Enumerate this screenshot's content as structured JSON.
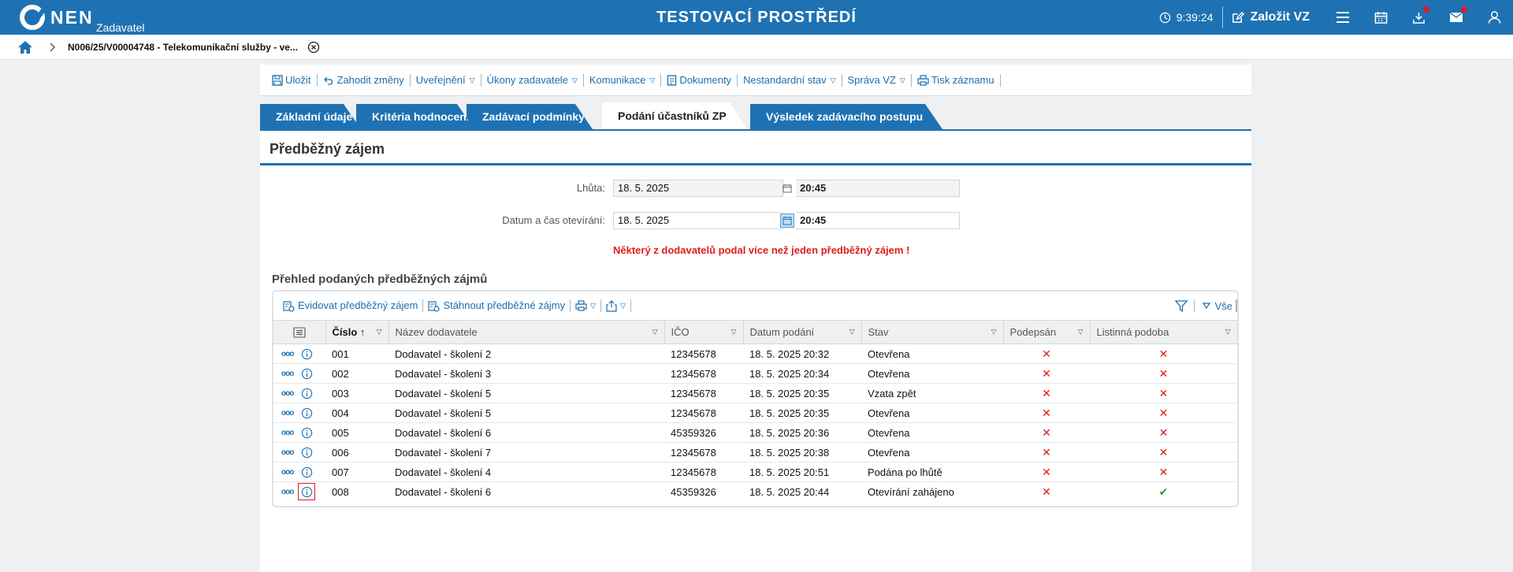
{
  "topbar": {
    "logo_text": "NEN",
    "logo_sub": "Zadavatel",
    "env_title": "TESTOVACÍ PROSTŘEDÍ",
    "timer": "9:39:24",
    "create_label": "Založit VZ",
    "icons": [
      "menu-icon",
      "calendar-icon",
      "download-icon",
      "mail-icon",
      "user-icon"
    ],
    "notification_color": "#e0192b"
  },
  "breadcrumb": {
    "text": "N006/25/V00004748 - Telekomunikační služby - ve..."
  },
  "toolbar": {
    "items": [
      {
        "label": "Uložit",
        "icon": "save-icon",
        "dropdown": false
      },
      {
        "label": "Zahodit změny",
        "icon": "undo-icon",
        "dropdown": false
      },
      {
        "label": "Uveřejnění",
        "icon": "",
        "dropdown": true
      },
      {
        "label": "Úkony zadavatele",
        "icon": "",
        "dropdown": true
      },
      {
        "label": "Komunikace",
        "icon": "",
        "dropdown": true
      },
      {
        "label": "Dokumenty",
        "icon": "document-icon",
        "dropdown": false
      },
      {
        "label": "Nestandardní stav",
        "icon": "",
        "dropdown": true
      },
      {
        "label": "Správa VZ",
        "icon": "",
        "dropdown": true
      },
      {
        "label": "Tisk záznamu",
        "icon": "print-icon",
        "dropdown": false
      }
    ]
  },
  "tabs": [
    {
      "label": "Základní údaje",
      "active": false
    },
    {
      "label": "Kritéria hodnocení",
      "active": false
    },
    {
      "label": "Zadávací podmínky",
      "active": false
    },
    {
      "label": "Podání účastníků ZP",
      "active": true
    },
    {
      "label": "Výsledek zadávacího postupu",
      "active": false
    }
  ],
  "section": {
    "title": "Předběžný zájem",
    "deadline": {
      "label": "Lhůta:",
      "date": "18. 5. 2025",
      "time": "20:45"
    },
    "opening": {
      "label": "Datum a čas otevírání:",
      "date": "18. 5. 2025",
      "time": "20:45"
    },
    "warning": "Některý z dodavatelů podal více než jeden předběžný zájem !",
    "overview_title": "Přehled podaných předběžných zájmů"
  },
  "grid": {
    "toolbar": {
      "register_label": "Evidovat předběžný zájem",
      "download_label": "Stáhnout předběžné zájmy",
      "filter_all_label": "Vše"
    },
    "columns": {
      "number": "Číslo",
      "supplier": "Název dodavatele",
      "ico": "IČO",
      "date": "Datum podání",
      "state": "Stav",
      "signed": "Podepsán",
      "paper": "Listinná podoba"
    },
    "rows": [
      {
        "number": "001",
        "supplier": "Dodavatel - školení 2",
        "ico": "12345678",
        "date": "18. 5. 2025 20:32",
        "state": "Otevřena",
        "signed": false,
        "paper": false
      },
      {
        "number": "002",
        "supplier": "Dodavatel - školení 3",
        "ico": "12345678",
        "date": "18. 5. 2025 20:34",
        "state": "Otevřena",
        "signed": false,
        "paper": false
      },
      {
        "number": "003",
        "supplier": "Dodavatel - školení 5",
        "ico": "12345678",
        "date": "18. 5. 2025 20:35",
        "state": "Vzata zpět",
        "signed": false,
        "paper": false
      },
      {
        "number": "004",
        "supplier": "Dodavatel - školení 5",
        "ico": "12345678",
        "date": "18. 5. 2025 20:35",
        "state": "Otevřena",
        "signed": false,
        "paper": false
      },
      {
        "number": "005",
        "supplier": "Dodavatel - školení 6",
        "ico": "45359326",
        "date": "18. 5. 2025 20:36",
        "state": "Otevřena",
        "signed": false,
        "paper": false
      },
      {
        "number": "006",
        "supplier": "Dodavatel - školení 7",
        "ico": "12345678",
        "date": "18. 5. 2025 20:38",
        "state": "Otevřena",
        "signed": false,
        "paper": false
      },
      {
        "number": "007",
        "supplier": "Dodavatel - školení 4",
        "ico": "12345678",
        "date": "18. 5. 2025 20:51",
        "state": "Podána po lhůtě",
        "signed": false,
        "paper": false
      },
      {
        "number": "008",
        "supplier": "Dodavatel - školení 6",
        "ico": "45359326",
        "date": "18. 5. 2025 20:44",
        "state": "Otevírání zahájeno",
        "signed": false,
        "paper": true
      }
    ]
  },
  "colors": {
    "brand": "#1e72b3",
    "link": "#1d6eab",
    "error": "#e01b1b",
    "success": "#2e9b3f"
  }
}
